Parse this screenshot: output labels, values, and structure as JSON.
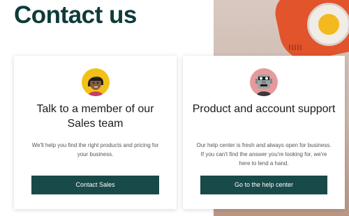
{
  "page": {
    "title": "Contact us"
  },
  "cards": [
    {
      "title": "Talk to a member of our Sales team",
      "description": "We'll help you find the right products and pricing for your business.",
      "button_label": "Contact Sales",
      "avatar_icon": "sales-person-avatar-icon"
    },
    {
      "title": "Product and account support",
      "description": "Our help center is fresh and always open for business. If you can't find the answer you're looking for, we're here to lend a hand.",
      "button_label": "Go to the help center",
      "avatar_icon": "support-robot-avatar-icon"
    }
  ],
  "colors": {
    "title": "#0f3b3a",
    "button_bg": "#184a49",
    "button_text": "#ffffff",
    "sales_avatar_bg": "#f2c118",
    "support_avatar_bg": "#e69a9c"
  }
}
